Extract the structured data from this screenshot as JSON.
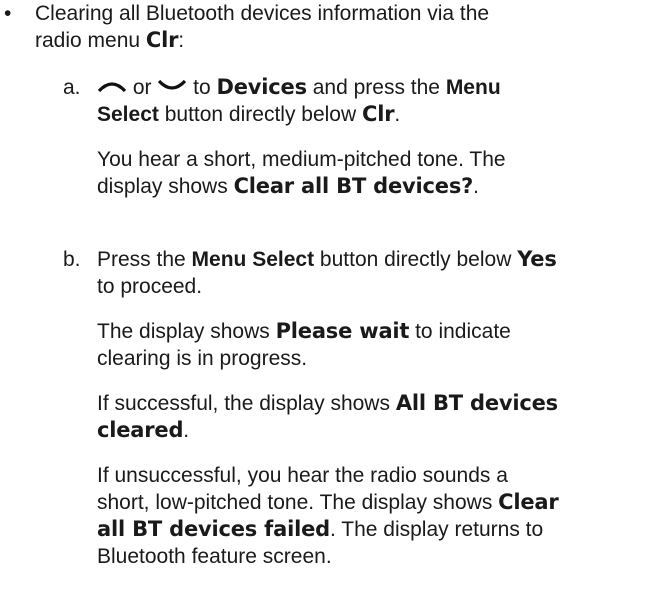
{
  "bullet": "•",
  "intro": {
    "line1": "Clearing all Bluetooth devices information via the",
    "line2_pre": "radio menu ",
    "line2_disp": "Clr",
    "line2_post": ":"
  },
  "step_a": {
    "letter": "a.",
    "or": " or ",
    "to": " to ",
    "devices": "Devices",
    "and_press": " and press the ",
    "menu": "Menu",
    "select": "Select",
    "below": " button directly below ",
    "clr": "Clr",
    "period": ".",
    "tone1": "You hear a short, medium-pitched tone. The",
    "tone2_pre": "display shows ",
    "tone2_disp": "Clear all BT devices?",
    "tone2_post": ".",
    "icons": [
      "chevron-up-icon",
      "chevron-down-icon"
    ]
  },
  "step_b": {
    "letter": "b.",
    "press": "Press the ",
    "menu_select": "Menu Select",
    "below": " button directly below ",
    "yes": "Yes",
    "proceed": "to proceed.",
    "wait_pre": "The display shows ",
    "wait_disp": "Please wait",
    "wait_post": " to indicate",
    "wait_line2": "clearing is in progress.",
    "success_pre": "If successful, the display shows ",
    "success_disp1": "All BT devices",
    "success_disp2": "cleared",
    "success_post": ".",
    "fail1": "If unsuccessful, you hear the radio sounds a",
    "fail2_pre": "short, low-pitched tone. The display shows ",
    "fail2_disp": "Clear",
    "fail3_disp": "all BT devices failed",
    "fail3_post": ". The display returns to",
    "fail4": "Bluetooth feature screen."
  }
}
